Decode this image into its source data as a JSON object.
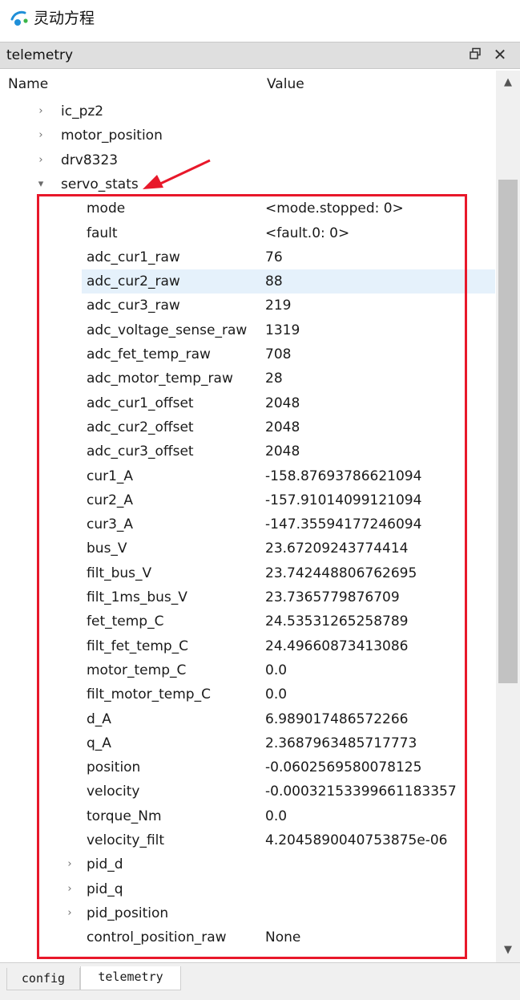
{
  "app": {
    "title": "灵动方程",
    "logo_icon": "app-logo-icon"
  },
  "dock": {
    "title": "telemetry",
    "float_icon": "float-window-icon",
    "close_icon": "close-icon"
  },
  "columns": {
    "name": "Name",
    "value": "Value"
  },
  "tree_rows": [
    {
      "name": "ic_pz2",
      "value": "",
      "level": 1,
      "expander": "collapsed"
    },
    {
      "name": "motor_position",
      "value": "",
      "level": 1,
      "expander": "collapsed"
    },
    {
      "name": "drv8323",
      "value": "",
      "level": 1,
      "expander": "collapsed"
    },
    {
      "name": "servo_stats",
      "value": "",
      "level": 1,
      "expander": "expanded"
    },
    {
      "name": "mode",
      "value": "<mode.stopped: 0>",
      "level": 2
    },
    {
      "name": "fault",
      "value": "<fault.0: 0>",
      "level": 2
    },
    {
      "name": "adc_cur1_raw",
      "value": "76",
      "level": 2
    },
    {
      "name": "adc_cur2_raw",
      "value": "88",
      "level": 2,
      "selected": true
    },
    {
      "name": "adc_cur3_raw",
      "value": "219",
      "level": 2
    },
    {
      "name": "adc_voltage_sense_raw",
      "value": "1319",
      "level": 2
    },
    {
      "name": "adc_fet_temp_raw",
      "value": "708",
      "level": 2
    },
    {
      "name": "adc_motor_temp_raw",
      "value": "28",
      "level": 2
    },
    {
      "name": "adc_cur1_offset",
      "value": "2048",
      "level": 2
    },
    {
      "name": "adc_cur2_offset",
      "value": "2048",
      "level": 2
    },
    {
      "name": "adc_cur3_offset",
      "value": "2048",
      "level": 2
    },
    {
      "name": "cur1_A",
      "value": "-158.87693786621094",
      "level": 2
    },
    {
      "name": "cur2_A",
      "value": "-157.91014099121094",
      "level": 2
    },
    {
      "name": "cur3_A",
      "value": "-147.35594177246094",
      "level": 2
    },
    {
      "name": "bus_V",
      "value": "23.67209243774414",
      "level": 2
    },
    {
      "name": "filt_bus_V",
      "value": "23.742448806762695",
      "level": 2
    },
    {
      "name": "filt_1ms_bus_V",
      "value": "23.7365779876709",
      "level": 2
    },
    {
      "name": "fet_temp_C",
      "value": "24.53531265258789",
      "level": 2
    },
    {
      "name": "filt_fet_temp_C",
      "value": "24.49660873413086",
      "level": 2
    },
    {
      "name": "motor_temp_C",
      "value": "0.0",
      "level": 2
    },
    {
      "name": "filt_motor_temp_C",
      "value": "0.0",
      "level": 2
    },
    {
      "name": "d_A",
      "value": "6.989017486572266",
      "level": 2
    },
    {
      "name": "q_A",
      "value": "2.3687963485717773",
      "level": 2
    },
    {
      "name": "position",
      "value": "-0.0602569580078125",
      "level": 2
    },
    {
      "name": "velocity",
      "value": "-0.00032153399661183357",
      "level": 2
    },
    {
      "name": "torque_Nm",
      "value": "0.0",
      "level": 2
    },
    {
      "name": "velocity_filt",
      "value": "4.2045890040753875e-06",
      "level": 2
    },
    {
      "name": "pid_d",
      "value": "",
      "level": 2,
      "expander": "collapsed"
    },
    {
      "name": "pid_q",
      "value": "",
      "level": 2,
      "expander": "collapsed"
    },
    {
      "name": "pid_position",
      "value": "",
      "level": 2,
      "expander": "collapsed"
    },
    {
      "name": "control_position_raw",
      "value": "None",
      "level": 2
    }
  ],
  "icons": {
    "expanded": "▾",
    "collapsed": "›",
    "scroll_up": "▲",
    "scroll_down": "▼"
  },
  "tabs": [
    {
      "label": "config",
      "active": false
    },
    {
      "label": "telemetry",
      "active": true
    }
  ],
  "colors": {
    "annotation": "#e8182a",
    "selection": "#e5f1fb",
    "header_bg": "#dfdfdf"
  }
}
